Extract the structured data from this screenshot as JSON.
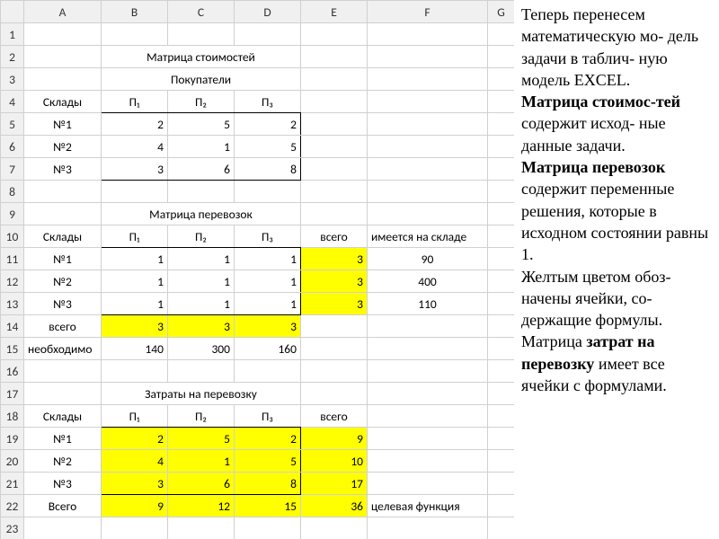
{
  "columns": [
    "A",
    "B",
    "C",
    "D",
    "E",
    "F",
    "G"
  ],
  "rows": [
    "1",
    "2",
    "3",
    "4",
    "5",
    "6",
    "7",
    "8",
    "9",
    "10",
    "11",
    "12",
    "13",
    "14",
    "15",
    "16",
    "17",
    "18",
    "19",
    "20",
    "21",
    "22",
    "23"
  ],
  "titles": {
    "cost_matrix": "Матрица стоимостей",
    "buyers": "Покупатели",
    "warehouses": "Склады",
    "transport_matrix": "Матрица перевозок",
    "costs_title": "Затраты на перевозку",
    "total": "всего",
    "in_stock": "имеется на складе",
    "needed": "необходимо",
    "total_cap": "Всего",
    "objective": "целевая функция"
  },
  "buyers": [
    "П₁",
    "П₂",
    "П₃"
  ],
  "warehouses": [
    "№1",
    "№2",
    "№3"
  ],
  "cost": [
    [
      2,
      5,
      2
    ],
    [
      4,
      1,
      5
    ],
    [
      3,
      6,
      8
    ]
  ],
  "ship": {
    "cells": [
      [
        1,
        1,
        1
      ],
      [
        1,
        1,
        1
      ],
      [
        1,
        1,
        1
      ]
    ],
    "row_totals": [
      3,
      3,
      3
    ],
    "stock": [
      90,
      400,
      110
    ],
    "col_totals": [
      3,
      3,
      3
    ],
    "demand": [
      140,
      300,
      160
    ]
  },
  "spend": {
    "cells": [
      [
        2,
        5,
        2
      ],
      [
        4,
        1,
        5
      ],
      [
        3,
        6,
        8
      ]
    ],
    "row_totals": [
      9,
      10,
      17
    ],
    "col_totals": [
      9,
      12,
      15
    ],
    "grand": 36
  },
  "side": {
    "p1a": "Теперь перенесем математическую мо-",
    "p1b": "дель задачи в таблич-",
    "p1c": "ную модель EXCEL.",
    "p2a": "Матрица стоимос-",
    "p2b": "тей",
    "p2c": " содержит исход-",
    "p2d": "ные данные задачи.",
    "p3a": "Матрица перевозок",
    "p3b": " содержит переменные решения, которые в исходном состоянии равны 1.",
    "p4a": "Желтым цветом обоз-",
    "p4b": "начены ячейки, со-",
    "p4c": "держащие формулы.",
    "p5a": "Матрица ",
    "p5b": "затрат на перевозку",
    "p5c": " имеет все ячейки с формулами."
  }
}
